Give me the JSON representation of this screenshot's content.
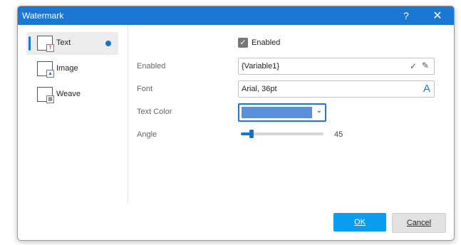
{
  "window": {
    "title": "Watermark",
    "help_glyph": "?",
    "close_glyph": "✕"
  },
  "nav": {
    "items": [
      {
        "label": "Text",
        "icon": "text-watermark-icon",
        "selected": true
      },
      {
        "label": "Image",
        "icon": "image-watermark-icon",
        "selected": false
      },
      {
        "label": "Weave",
        "icon": "weave-watermark-icon",
        "selected": false
      }
    ]
  },
  "form": {
    "enabled_checkbox_label": "Enabled",
    "enabled_checked": true,
    "text_label": "Enabled",
    "text_value": "{Variable1}",
    "font_label": "Font",
    "font_value": "Arial, 36pt",
    "color_label": "Text Color",
    "color_value": "#5b8fd9",
    "angle_label": "Angle",
    "angle_value": "45",
    "angle_fraction": 0.13
  },
  "buttons": {
    "ok_label": "OK",
    "cancel_label": "Cancel"
  },
  "colors": {
    "accent": "#1a78d4",
    "ok_button": "#0a9ef0"
  }
}
